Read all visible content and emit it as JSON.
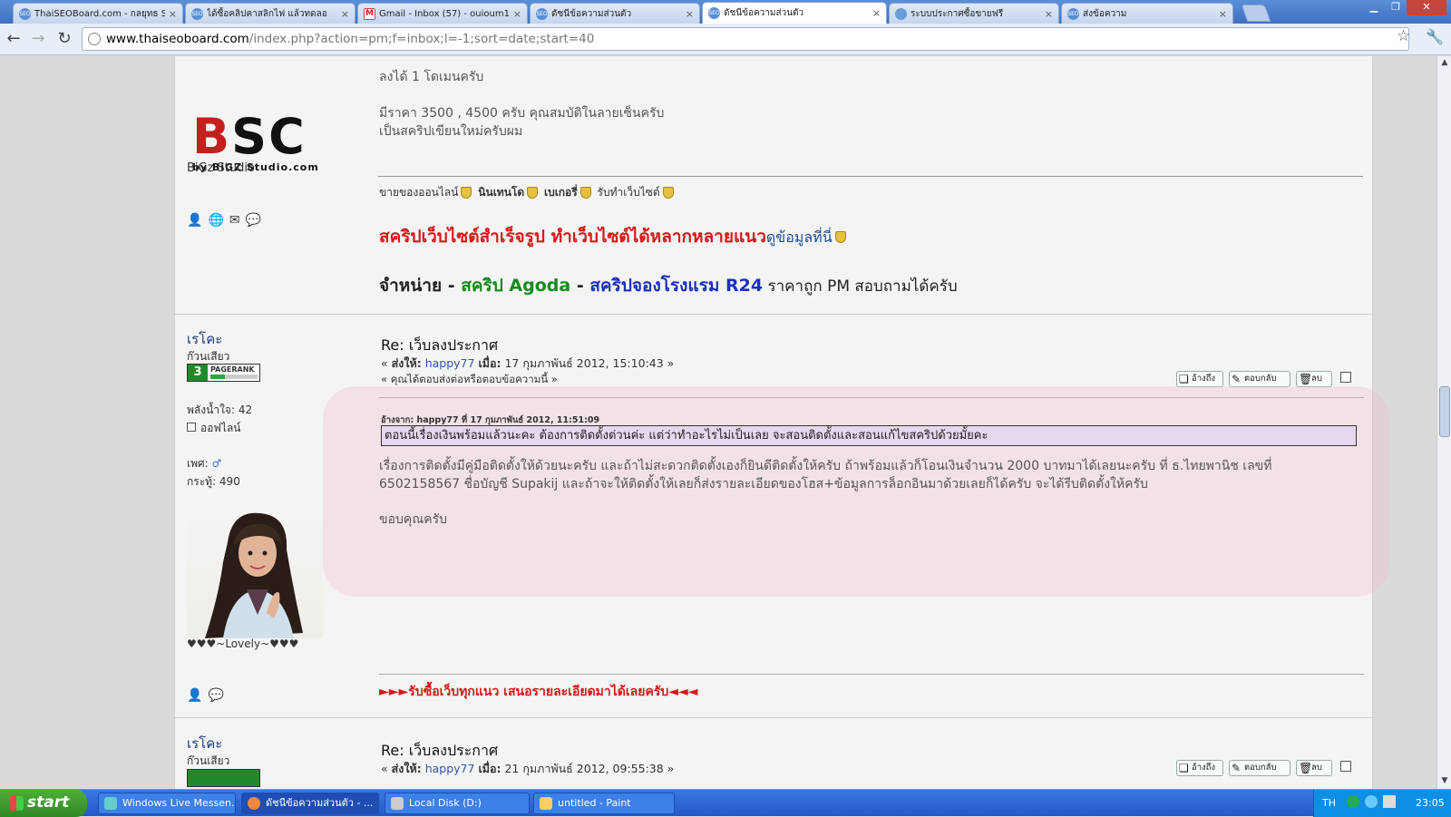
{
  "browser": {
    "tabs": [
      {
        "title": "ThaiSEOBoard.com - กลยุทธ SE",
        "icon": "seo-icon"
      },
      {
        "title": "ได้ซื้อคลิปคาสลิกไฟ แล้วทดลอ",
        "icon": "seo-icon"
      },
      {
        "title": "Gmail - Inbox (57) - ouioum11",
        "icon": "gmail-icon"
      },
      {
        "title": "ดัชนีข้อความส่วนตัว",
        "icon": "seo-icon"
      },
      {
        "title": "ดัชนีข้อความส่วนตัว",
        "icon": "seo-icon",
        "active": true
      },
      {
        "title": "ระบบประกาศซื้อขายฟรี",
        "icon": "globe-icon"
      },
      {
        "title": "ส่งข้อความ",
        "icon": "seo-icon"
      }
    ],
    "url_domain": "www.thaiseoboard.com",
    "url_path": "/index.php?action=pm;f=inbox;l=-1;sort=date;start=40"
  },
  "post0": {
    "logo_text": "BSC",
    "logo_sub": "by BiGZ Studio.com",
    "author_name": "BiGz Studio",
    "lines": [
      "ลงได้ 1 โดเมนครับ",
      "มีราคา  3500 , 4500 ครับ คุณสมบัติในลายเซ็นครับ",
      "เป็นสคริปเขียนใหม่ครับผม"
    ],
    "sig_small": "ขายของออนไลน์",
    "sig_links": [
      "นินเทนโด",
      "เบเกอรี่",
      "รับทำเว็บไซต์"
    ],
    "sig_red": "สคริปเว็บไซต์สำเร็จรูป ทำเว็บไซต์ได้หลากหลายแนว",
    "sig_more": "ดูข้อมูลที่นี่",
    "sig2_a": "จำหน่าย - ",
    "sig2_b": "สคริป Agoda",
    "sig2_c": " - ",
    "sig2_d": "สคริปจองโรงแรม R24",
    "sig2_e": " ราคาถูก PM สอบถามได้ครับ"
  },
  "post1": {
    "author": "เรโคะ",
    "rank": "ก๊วนเสียว",
    "pagerank": "3",
    "pagerank_label": "PAGERANK",
    "pagerank_fill": 0.3,
    "power": "พลังน้ำใจ: 42",
    "status": "ออฟไลน์",
    "gender_label": "เพศ:",
    "topics": "กระทู้: 490",
    "signature_name": "♥♥♥~Lovely~♥♥♥",
    "subject": "Re: เว็บลงประกาศ",
    "meta_prefix": "« ",
    "meta_sender_label": "ส่งให้:",
    "meta_user": "happy77",
    "meta_date_label": "เมื่อ:",
    "meta_date": "17 กุมภาพันธ์ 2012, 15:10:43 »",
    "replied_note": "« คุณได้ตอบส่งต่อหรือตอบข้อความนี้ »",
    "btn_quote": "อ้างถึง",
    "btn_reply": "ตอบกลับ",
    "btn_delete": "ลบ",
    "quote_header": "อ้างจาก: happy77 ที่ 17 กุมภาพันธ์ 2012, 11:51:09",
    "quote_text": "ตอนนี้เรื่องเงินพร้อมแล้วนะคะ  ต้องการติดตั้งด่วนค่ะ แต่ว่าทำอะไรไม่เป็นเลย จะสอนติดตั้งและสอนแก้ไขสคริปด้วยมั้ยคะ",
    "body1": "เรื่องการติดตั้งมีคู่มือติดตั้งให้ด้วยนะครับ และถ้าไม่สะดวกติดตั้งเองก็ยินดีติดตั้งให้ครับ ถ้าพร้อมแล้วก็โอนเงินจำนวน 2000 บาทมาได้เลยนะครับ ที่ ธ.ไทยพานิช เลขที่",
    "body2": "6502158567 ชื่อบัญชี Supakij  และถ้าจะให้ติดตั้งให้เลยก็ส่งรายละเอียดของโฮส+ข้อมูลการล็อกอินมาด้วยเลยก็ได้ครับ จะได้รีบติดตั้งให้ครับ",
    "thanks": "ขอบคุณครับ",
    "signature_line": "►►►รับซื้อเว็บทุกแนว เสนอรายละเอียดมาได้เลยครับ◄◄◄"
  },
  "post2": {
    "author": "เรโคะ",
    "rank": "ก๊วนเสียว",
    "subject": "Re: เว็บลงประกาศ",
    "meta_prefix": "« ",
    "meta_sender_label": "ส่งให้:",
    "meta_user": "happy77",
    "meta_date_label": "เมื่อ:",
    "meta_date": "21 กุมภาพันธ์ 2012, 09:55:38 »",
    "btn_quote": "อ้างถึง",
    "btn_reply": "ตอบกลับ",
    "btn_delete": "ลบ"
  },
  "taskbar": {
    "start": "start",
    "items": [
      {
        "label": "Windows Live Messen..."
      },
      {
        "label": "ดัชนีข้อความส่วนตัว - ..."
      },
      {
        "label": "Local Disk (D:)"
      },
      {
        "label": "untitled - Paint"
      }
    ],
    "lang": "TH",
    "clock": "23:05"
  },
  "colors": {
    "accent_red": "#d81818",
    "agoda_green": "#118a1b",
    "r24_blue": "#1a2ec0",
    "link_blue": "#3355aa"
  }
}
